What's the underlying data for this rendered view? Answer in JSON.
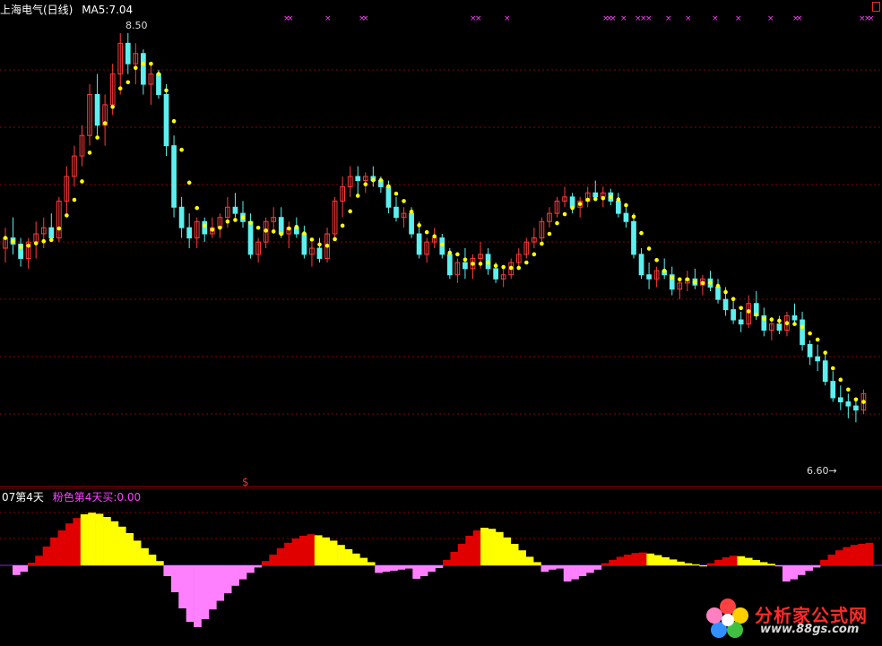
{
  "main_header": {
    "symbol": "上海电气(日线)",
    "ma_label": "MA5:7.04"
  },
  "sub_header": {
    "indicator": "07第4天",
    "signal_label": "粉色第4天买:0.00"
  },
  "annotations": {
    "high_label": "8.50",
    "low_label": "6.60→",
    "corner_marker": "$"
  },
  "logo": {
    "text": "分析家公式网",
    "url": "www.88gs.com"
  },
  "colors": {
    "up": "#ff3b3b",
    "down": "#5cf0f0",
    "ma": "#ffff00",
    "grid": "#8b0000",
    "magenta": "#ff40ff",
    "hist_red": "#e00000",
    "hist_yellow": "#ffff00",
    "hist_pink": "#ff80ff",
    "baseline": "#8a2be2"
  },
  "chart_data": [
    {
      "type": "candlestick",
      "title": "上海电气(日线)",
      "series": [
        {
          "name": "MA5"
        }
      ],
      "ylim": [
        6.3,
        8.6
      ],
      "ma_last": 7.04,
      "marked_high": 8.5,
      "marked_low": 6.6,
      "ohlc": [
        [
          7.45,
          7.55,
          7.38,
          7.5
        ],
        [
          7.5,
          7.6,
          7.42,
          7.47
        ],
        [
          7.47,
          7.5,
          7.36,
          7.4
        ],
        [
          7.4,
          7.5,
          7.35,
          7.48
        ],
        [
          7.48,
          7.58,
          7.4,
          7.52
        ],
        [
          7.52,
          7.6,
          7.45,
          7.55
        ],
        [
          7.55,
          7.62,
          7.48,
          7.5
        ],
        [
          7.5,
          7.7,
          7.48,
          7.68
        ],
        [
          7.68,
          7.85,
          7.62,
          7.8
        ],
        [
          7.8,
          7.95,
          7.75,
          7.9
        ],
        [
          7.9,
          8.05,
          7.85,
          8.0
        ],
        [
          8.0,
          8.25,
          7.95,
          8.2
        ],
        [
          8.2,
          8.3,
          8.0,
          8.05
        ],
        [
          8.05,
          8.2,
          7.95,
          8.15
        ],
        [
          8.15,
          8.35,
          8.1,
          8.3
        ],
        [
          8.3,
          8.5,
          8.2,
          8.45
        ],
        [
          8.45,
          8.5,
          8.3,
          8.35
        ],
        [
          8.35,
          8.45,
          8.25,
          8.4
        ],
        [
          8.4,
          8.42,
          8.2,
          8.25
        ],
        [
          8.25,
          8.35,
          8.15,
          8.3
        ],
        [
          8.3,
          8.32,
          8.18,
          8.2
        ],
        [
          8.2,
          8.25,
          7.9,
          7.95
        ],
        [
          7.95,
          8.0,
          7.6,
          7.65
        ],
        [
          7.65,
          7.7,
          7.5,
          7.55
        ],
        [
          7.55,
          7.62,
          7.45,
          7.5
        ],
        [
          7.5,
          7.6,
          7.45,
          7.58
        ],
        [
          7.58,
          7.6,
          7.48,
          7.52
        ],
        [
          7.52,
          7.6,
          7.5,
          7.55
        ],
        [
          7.55,
          7.62,
          7.5,
          7.6
        ],
        [
          7.6,
          7.7,
          7.55,
          7.65
        ],
        [
          7.65,
          7.72,
          7.6,
          7.62
        ],
        [
          7.62,
          7.68,
          7.55,
          7.58
        ],
        [
          7.58,
          7.62,
          7.4,
          7.42
        ],
        [
          7.42,
          7.5,
          7.38,
          7.48
        ],
        [
          7.48,
          7.6,
          7.45,
          7.58
        ],
        [
          7.58,
          7.65,
          7.52,
          7.6
        ],
        [
          7.6,
          7.65,
          7.5,
          7.52
        ],
        [
          7.52,
          7.58,
          7.45,
          7.55
        ],
        [
          7.55,
          7.6,
          7.5,
          7.52
        ],
        [
          7.52,
          7.56,
          7.4,
          7.42
        ],
        [
          7.42,
          7.48,
          7.36,
          7.45
        ],
        [
          7.45,
          7.5,
          7.38,
          7.4
        ],
        [
          7.4,
          7.55,
          7.38,
          7.52
        ],
        [
          7.52,
          7.7,
          7.5,
          7.68
        ],
        [
          7.68,
          7.8,
          7.6,
          7.75
        ],
        [
          7.75,
          7.85,
          7.7,
          7.8
        ],
        [
          7.8,
          7.85,
          7.7,
          7.78
        ],
        [
          7.78,
          7.82,
          7.72,
          7.8
        ],
        [
          7.8,
          7.85,
          7.75,
          7.78
        ],
        [
          7.78,
          7.8,
          7.72,
          7.75
        ],
        [
          7.75,
          7.78,
          7.62,
          7.65
        ],
        [
          7.65,
          7.7,
          7.58,
          7.6
        ],
        [
          7.6,
          7.65,
          7.55,
          7.62
        ],
        [
          7.62,
          7.65,
          7.5,
          7.52
        ],
        [
          7.52,
          7.58,
          7.4,
          7.42
        ],
        [
          7.42,
          7.5,
          7.38,
          7.48
        ],
        [
          7.48,
          7.55,
          7.45,
          7.5
        ],
        [
          7.5,
          7.52,
          7.4,
          7.42
        ],
        [
          7.42,
          7.45,
          7.3,
          7.32
        ],
        [
          7.32,
          7.4,
          7.28,
          7.38
        ],
        [
          7.38,
          7.45,
          7.3,
          7.35
        ],
        [
          7.35,
          7.42,
          7.3,
          7.4
        ],
        [
          7.4,
          7.48,
          7.35,
          7.42
        ],
        [
          7.42,
          7.45,
          7.32,
          7.35
        ],
        [
          7.35,
          7.38,
          7.28,
          7.3
        ],
        [
          7.3,
          7.35,
          7.26,
          7.32
        ],
        [
          7.32,
          7.4,
          7.3,
          7.38
        ],
        [
          7.38,
          7.45,
          7.35,
          7.42
        ],
        [
          7.42,
          7.5,
          7.4,
          7.48
        ],
        [
          7.48,
          7.55,
          7.45,
          7.5
        ],
        [
          7.5,
          7.6,
          7.48,
          7.58
        ],
        [
          7.58,
          7.65,
          7.55,
          7.62
        ],
        [
          7.62,
          7.7,
          7.6,
          7.68
        ],
        [
          7.68,
          7.75,
          7.65,
          7.7
        ],
        [
          7.7,
          7.72,
          7.62,
          7.65
        ],
        [
          7.65,
          7.7,
          7.6,
          7.68
        ],
        [
          7.68,
          7.75,
          7.65,
          7.72
        ],
        [
          7.72,
          7.78,
          7.68,
          7.7
        ],
        [
          7.7,
          7.75,
          7.65,
          7.72
        ],
        [
          7.72,
          7.74,
          7.66,
          7.68
        ],
        [
          7.68,
          7.72,
          7.6,
          7.62
        ],
        [
          7.62,
          7.66,
          7.55,
          7.58
        ],
        [
          7.58,
          7.62,
          7.4,
          7.42
        ],
        [
          7.42,
          7.45,
          7.3,
          7.32
        ],
        [
          7.32,
          7.38,
          7.25,
          7.3
        ],
        [
          7.3,
          7.36,
          7.26,
          7.34
        ],
        [
          7.34,
          7.4,
          7.3,
          7.32
        ],
        [
          7.32,
          7.36,
          7.22,
          7.25
        ],
        [
          7.25,
          7.3,
          7.2,
          7.28
        ],
        [
          7.28,
          7.34,
          7.24,
          7.3
        ],
        [
          7.3,
          7.35,
          7.25,
          7.27
        ],
        [
          7.27,
          7.32,
          7.22,
          7.3
        ],
        [
          7.3,
          7.34,
          7.24,
          7.26
        ],
        [
          7.26,
          7.3,
          7.18,
          7.2
        ],
        [
          7.2,
          7.26,
          7.12,
          7.15
        ],
        [
          7.15,
          7.2,
          7.08,
          7.1
        ],
        [
          7.1,
          7.14,
          7.04,
          7.08
        ],
        [
          7.08,
          7.22,
          7.06,
          7.18
        ],
        [
          7.18,
          7.24,
          7.1,
          7.12
        ],
        [
          7.12,
          7.16,
          7.02,
          7.05
        ],
        [
          7.05,
          7.1,
          7.0,
          7.08
        ],
        [
          7.08,
          7.12,
          7.03,
          7.05
        ],
        [
          7.05,
          7.14,
          7.02,
          7.12
        ],
        [
          7.12,
          7.18,
          7.08,
          7.1
        ],
        [
          7.1,
          7.14,
          6.95,
          6.98
        ],
        [
          6.98,
          7.0,
          6.88,
          6.92
        ],
        [
          6.92,
          6.98,
          6.85,
          6.9
        ],
        [
          6.9,
          6.94,
          6.78,
          6.8
        ],
        [
          6.8,
          6.85,
          6.7,
          6.72
        ],
        [
          6.72,
          6.78,
          6.66,
          6.7
        ],
        [
          6.7,
          6.74,
          6.62,
          6.68
        ],
        [
          6.68,
          6.72,
          6.6,
          6.66
        ],
        [
          6.66,
          6.76,
          6.64,
          6.74
        ]
      ]
    },
    {
      "type": "bar",
      "title": "07第4天",
      "series": [
        {
          "name": "粉色第4天买",
          "last": 0.0
        }
      ],
      "ylim": [
        -1.2,
        1.0
      ],
      "values": [
        -0.18,
        -0.12,
        0.05,
        0.18,
        0.35,
        0.52,
        0.65,
        0.78,
        0.88,
        0.95,
        0.98,
        0.96,
        0.9,
        0.82,
        0.72,
        0.6,
        0.46,
        0.32,
        0.2,
        0.08,
        -0.2,
        -0.5,
        -0.8,
        -1.05,
        -1.15,
        -1.0,
        -0.82,
        -0.66,
        -0.52,
        -0.38,
        -0.26,
        -0.14,
        -0.04,
        0.08,
        0.2,
        0.32,
        0.42,
        0.5,
        0.55,
        0.58,
        0.56,
        0.52,
        0.46,
        0.38,
        0.3,
        0.22,
        0.14,
        0.06,
        -0.14,
        -0.12,
        -0.1,
        -0.08,
        -0.06,
        -0.25,
        -0.2,
        -0.12,
        -0.05,
        0.1,
        0.25,
        0.4,
        0.55,
        0.65,
        0.7,
        0.68,
        0.62,
        0.52,
        0.4,
        0.28,
        0.16,
        0.06,
        -0.12,
        -0.08,
        -0.06,
        -0.3,
        -0.26,
        -0.2,
        -0.14,
        -0.08,
        0.04,
        0.1,
        0.16,
        0.2,
        0.23,
        0.24,
        0.22,
        0.19,
        0.15,
        0.11,
        0.07,
        0.04,
        0.02,
        -0.02,
        0.04,
        0.1,
        0.15,
        0.18,
        0.17,
        0.14,
        0.1,
        0.06,
        0.03,
        -0.02,
        -0.3,
        -0.26,
        -0.18,
        -0.1,
        -0.04,
        0.1,
        0.2,
        0.28,
        0.34,
        0.38,
        0.4,
        0.42
      ],
      "colors": [
        "p",
        "p",
        "r",
        "r",
        "r",
        "r",
        "r",
        "r",
        "r",
        "y",
        "y",
        "y",
        "y",
        "y",
        "y",
        "y",
        "y",
        "y",
        "y",
        "y",
        "p",
        "p",
        "p",
        "p",
        "p",
        "p",
        "p",
        "p",
        "p",
        "p",
        "p",
        "p",
        "p",
        "r",
        "r",
        "r",
        "r",
        "r",
        "r",
        "r",
        "y",
        "y",
        "y",
        "y",
        "y",
        "y",
        "y",
        "y",
        "p",
        "p",
        "p",
        "p",
        "p",
        "p",
        "p",
        "p",
        "p",
        "r",
        "r",
        "r",
        "r",
        "r",
        "y",
        "y",
        "y",
        "y",
        "y",
        "y",
        "y",
        "y",
        "p",
        "p",
        "p",
        "p",
        "p",
        "p",
        "p",
        "p",
        "r",
        "r",
        "r",
        "r",
        "r",
        "r",
        "y",
        "y",
        "y",
        "y",
        "y",
        "y",
        "y",
        "y",
        "r",
        "r",
        "r",
        "r",
        "y",
        "y",
        "y",
        "y",
        "y",
        "p",
        "p",
        "p",
        "p",
        "p",
        "p",
        "r",
        "r",
        "r",
        "r",
        "r",
        "r",
        "r"
      ]
    }
  ]
}
